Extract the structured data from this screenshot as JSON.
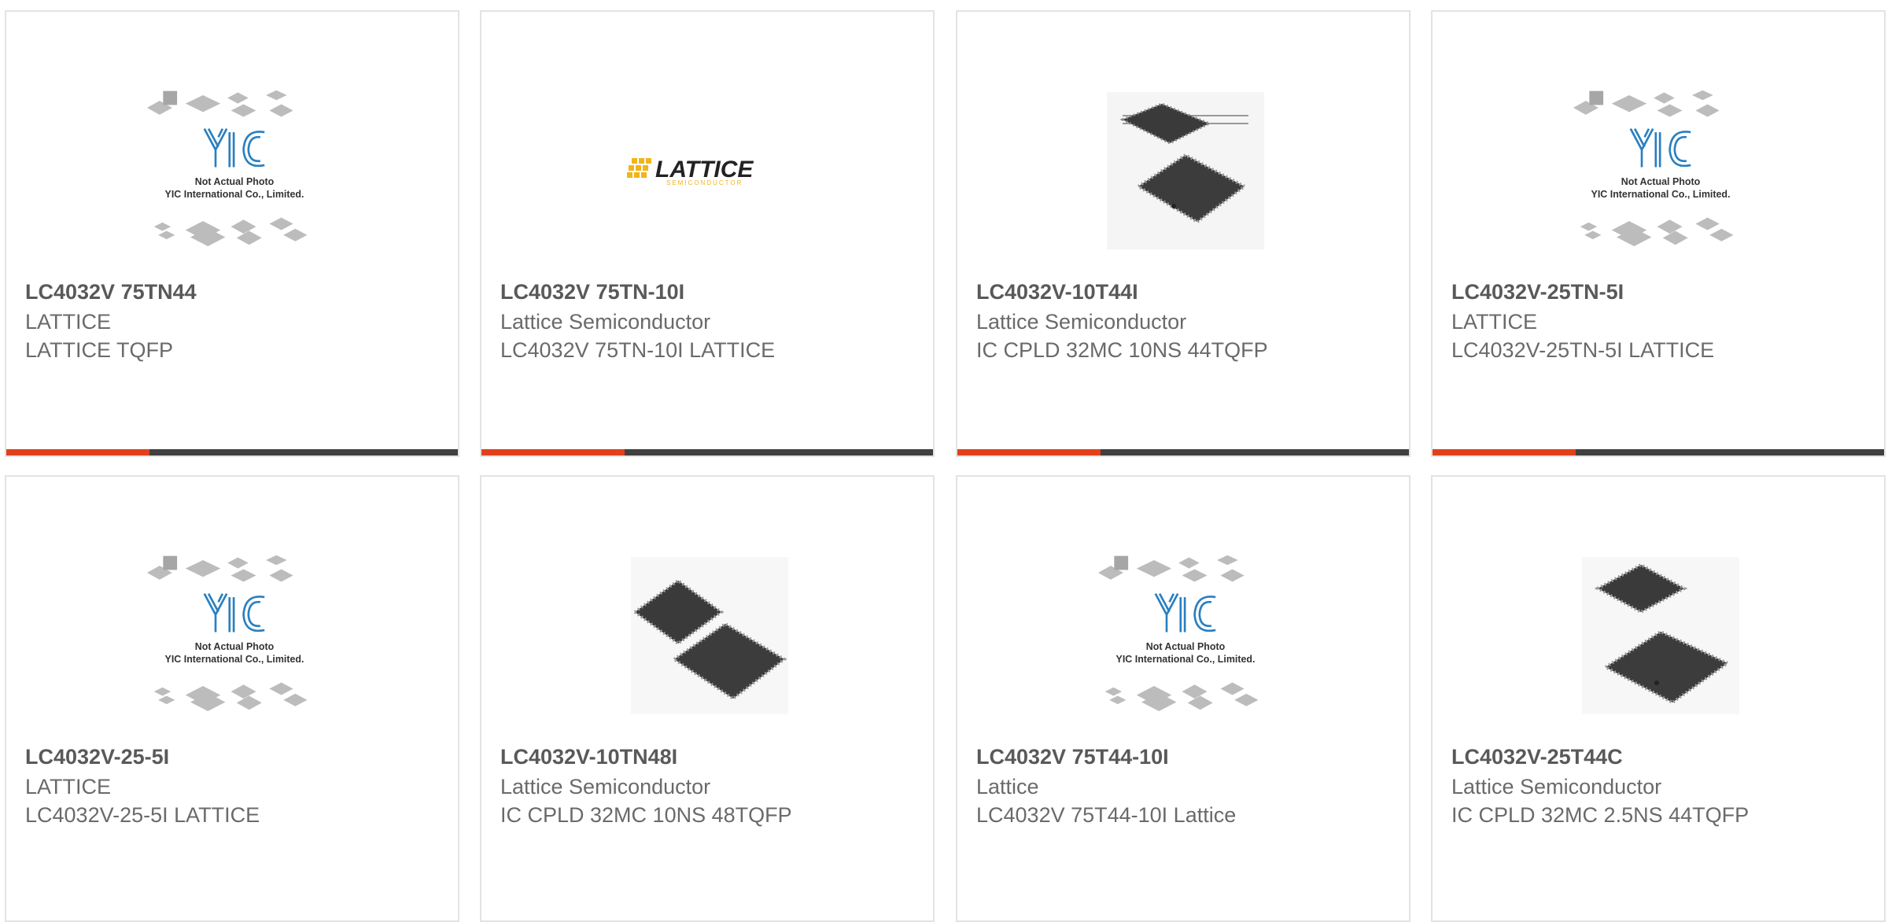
{
  "colors": {
    "accent": "#e2401c",
    "bar": "#404040",
    "title": "#595959",
    "text": "#6a6a6a",
    "yic_blue": "#2a7fc0",
    "lattice_gold": "#f2b418"
  },
  "cards": [
    {
      "title": "LC4032V 75TN44",
      "manufacturer": "LATTICE",
      "description": "LATTICE TQFP",
      "image": "yic-placeholder-image",
      "placeholder_line1": "Not Actual Photo",
      "placeholder_line2": "YIC International Co., Limited.",
      "placeholder_logo": "YIC"
    },
    {
      "title": "LC4032V 75TN-10I",
      "manufacturer": "Lattice Semiconductor",
      "description": "LC4032V 75TN-10I LATTICE",
      "image": "lattice-logo-image",
      "logo_text": "LATTICE",
      "logo_subtext": "SEMICONDUCTOR"
    },
    {
      "title": "LC4032V-10T44I",
      "manufacturer": "Lattice Semiconductor",
      "description": "IC CPLD 32MC 10NS 44TQFP",
      "image": "tqfp-chip-image"
    },
    {
      "title": "LC4032V-25TN-5I",
      "manufacturer": "LATTICE",
      "description": "LC4032V-25TN-5I LATTICE",
      "image": "yic-placeholder-image",
      "placeholder_line1": "Not Actual Photo",
      "placeholder_line2": "YIC International Co., Limited.",
      "placeholder_logo": "YIC"
    },
    {
      "title": "LC4032V-25-5I",
      "manufacturer": "LATTICE",
      "description": "LC4032V-25-5I LATTICE",
      "image": "yic-placeholder-image",
      "placeholder_line1": "Not Actual Photo",
      "placeholder_line2": "YIC International Co., Limited.",
      "placeholder_logo": "YIC"
    },
    {
      "title": "LC4032V-10TN48I",
      "manufacturer": "Lattice Semiconductor",
      "description": "IC CPLD 32MC 10NS 48TQFP",
      "image": "tqfp-chip-image"
    },
    {
      "title": "LC4032V 75T44-10I",
      "manufacturer": "Lattice",
      "description": "LC4032V 75T44-10I Lattice",
      "image": "yic-placeholder-image",
      "placeholder_line1": "Not Actual Photo",
      "placeholder_line2": "YIC International Co., Limited.",
      "placeholder_logo": "YIC"
    },
    {
      "title": "LC4032V-25T44C",
      "manufacturer": "Lattice Semiconductor",
      "description": "IC CPLD 32MC 2.5NS 44TQFP",
      "image": "tqfp-chip-image"
    }
  ]
}
